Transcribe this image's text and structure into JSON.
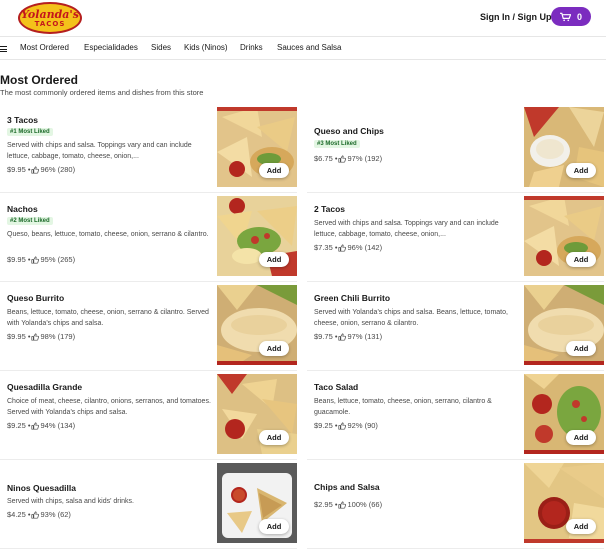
{
  "header": {
    "logo_line1": "Yolanda's",
    "logo_line2": "TACOS",
    "sign_in": "Sign In / Sign Up",
    "cart_count": "0"
  },
  "nav": {
    "items": [
      "Most Ordered",
      "Especialidades",
      "Sides",
      "Kids (Ninos)",
      "Drinks",
      "Sauces and Salsa"
    ]
  },
  "section": {
    "title": "Most Ordered",
    "subtitle": "The most commonly ordered items and dishes from this store"
  },
  "add_label": "Add",
  "items": [
    {
      "name": "3 Tacos",
      "badge": "#1 Most Liked",
      "desc": "Served with chips and salsa. Toppings vary and can include lettuce, cabbage, tomato, cheese, onion,...",
      "price": "$9.95 •",
      "rating": "96% (280)",
      "photo": "tacos"
    },
    {
      "name": "Queso and Chips",
      "badge": "#3 Most Liked",
      "desc": "",
      "price": "$6.75 •",
      "rating": "97% (192)",
      "photo": "queso"
    },
    {
      "name": "Nachos",
      "badge": "#2 Most Liked",
      "desc": "Queso, beans, lettuce, tomato, cheese, onion, serrano & cilantro.",
      "price": "$9.95 •",
      "rating": "95% (265)",
      "photo": "nachos"
    },
    {
      "name": "2 Tacos",
      "badge": "",
      "desc": "Served with chips and salsa. Toppings vary and can include lettuce, cabbage, tomato, cheese, onion,...",
      "price": "$7.35 •",
      "rating": "96% (142)",
      "photo": "tacos"
    },
    {
      "name": "Queso Burrito",
      "badge": "",
      "desc": "Beans, lettuce, tomato, cheese, onion, serrano & cilantro. Served with Yolanda's chips and salsa.",
      "price": "$9.95 •",
      "rating": "98% (179)",
      "photo": "burrito"
    },
    {
      "name": "Green Chili Burrito",
      "badge": "",
      "desc": "Served with Yolanda's chips and salsa. Beans, lettuce, tomato, cheese, onion, serrano & cilantro.",
      "price": "$9.75 •",
      "rating": "97% (131)",
      "photo": "burrito"
    },
    {
      "name": "Quesadilla Grande",
      "badge": "",
      "desc": "Choice of meat, cheese, cilantro, onions, serranos, and tomatoes. Served with Yolanda's chips and salsa.",
      "price": "$9.25 •",
      "rating": "94% (134)",
      "photo": "quesadilla"
    },
    {
      "name": "Taco Salad",
      "badge": "",
      "desc": "Beans, lettuce, tomato, cheese, onion, serrano, cilantro & guacamole.",
      "price": "$9.25 •",
      "rating": "92% (90)",
      "photo": "salad"
    },
    {
      "name": "Ninos Quesadilla",
      "badge": "",
      "desc": "Served with chips, salsa and kids' drinks.",
      "price": "$4.25 •",
      "rating": "93% (62)",
      "photo": "kids"
    },
    {
      "name": "Chips and Salsa",
      "badge": "",
      "desc": "",
      "price": "$2.95 •",
      "rating": "100% (66)",
      "photo": "chips"
    }
  ],
  "colors": {
    "accent": "#7b2cbf",
    "badge_text": "#1d6b2a",
    "badge_bg": "#e3f6e3",
    "logo_yellow": "#f4c21a",
    "logo_red": "#c4161c"
  }
}
